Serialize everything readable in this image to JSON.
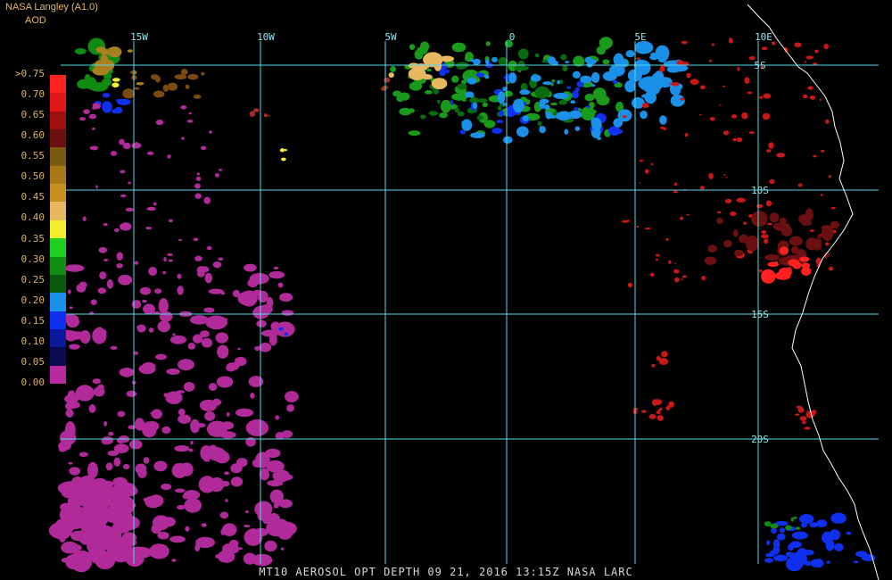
{
  "header": {
    "source": "NASA Langley (A1.0)",
    "variable": "AOD"
  },
  "legend": {
    "ticks": [
      ">0.75",
      "0.70",
      "0.65",
      "0.60",
      "0.55",
      "0.50",
      "0.45",
      "0.40",
      "0.35",
      "0.30",
      "0.25",
      "0.20",
      "0.15",
      "0.10",
      "0.05",
      "0.00"
    ],
    "colors": [
      "#ff2020",
      "#e01818",
      "#a01010",
      "#6a1010",
      "#7a5a10",
      "#a87818",
      "#c89020",
      "#e8b860",
      "#f4f030",
      "#20d020",
      "#109010",
      "#0a5a10",
      "#1a90e8",
      "#1030f0",
      "#0a1a9a",
      "#0a0a50",
      "#b82aa0"
    ]
  },
  "grid": {
    "lon_labels": [
      "15W",
      "10W",
      "5W",
      "0",
      "5E",
      "10E"
    ],
    "lat_labels": [
      "5S",
      "10S",
      "15S",
      "20S"
    ]
  },
  "footer": "MT10  AEROSOL OPT DEPTH   09 21, 2016 13:15Z   NASA LARC"
}
